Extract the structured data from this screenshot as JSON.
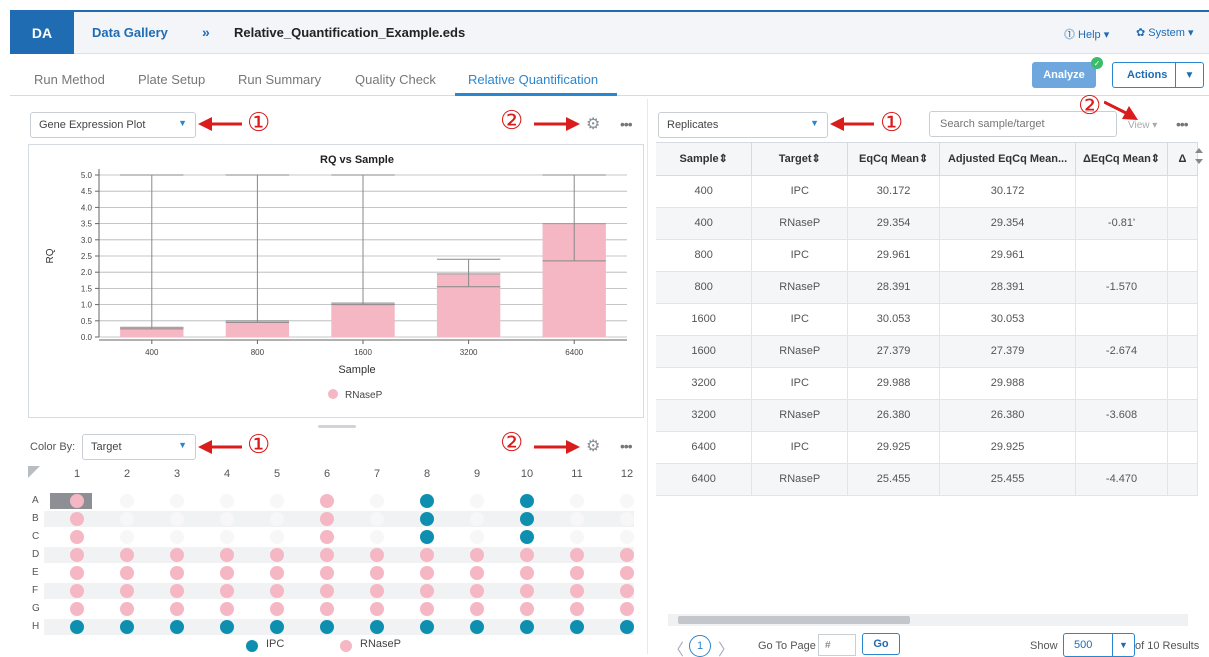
{
  "header": {
    "logo": "DA",
    "breadcrumb_root": "Data Gallery",
    "breadcrumb_sep": "»",
    "file_name": "Relative_Quantification_Example.eds",
    "help_label": "⓵ Help ▾",
    "system_label": "✿ System ▾"
  },
  "tabs": [
    {
      "label": "Run Method"
    },
    {
      "label": "Plate Setup"
    },
    {
      "label": "Run Summary"
    },
    {
      "label": "Quality Check"
    },
    {
      "label": "Relative Quantification"
    }
  ],
  "toolbar": {
    "analyze_label": "Analyze",
    "actions_label": "Actions"
  },
  "annotations": {
    "one": "①",
    "two": "②"
  },
  "left_panel": {
    "plot_select": "Gene Expression Plot",
    "dots": "•••"
  },
  "chart_data": {
    "type": "bar",
    "title": "RQ vs Sample",
    "xlabel": "Sample",
    "ylabel": "RQ",
    "categories": [
      "400",
      "800",
      "1600",
      "3200",
      "6400"
    ],
    "series": [
      {
        "name": "RNaseP",
        "color": "#f4b7c3",
        "values": [
          0.3,
          0.5,
          1.05,
          1.95,
          3.5
        ],
        "err_low": [
          0.25,
          0.45,
          1.0,
          1.55,
          2.35
        ],
        "err_high": [
          5.0,
          5.0,
          5.0,
          2.4,
          5.0
        ]
      }
    ],
    "y_ticks": [
      "0.0",
      "0.5",
      "1.0",
      "1.5",
      "2.0",
      "2.5",
      "3.0",
      "3.5",
      "4.0",
      "4.5",
      "5.0"
    ],
    "ylim": [
      0,
      5.0
    ],
    "grid": true,
    "legend": "bottom"
  },
  "plate": {
    "color_by_label": "Color By:",
    "color_by_value": "Target",
    "columns": [
      "1",
      "2",
      "3",
      "4",
      "5",
      "6",
      "7",
      "8",
      "9",
      "10",
      "11",
      "12"
    ],
    "rows": [
      "A",
      "B",
      "C",
      "D",
      "E",
      "F",
      "G",
      "H"
    ],
    "colors": {
      "I": "#0e8fb0",
      "R": "#f4b7c3",
      "E": "#f7f7f7"
    },
    "wells": [
      "REEEEREIEIEE",
      "REEEEREIEIEE",
      "REEEEREIEIEE",
      "RRRRRRRRRRRR",
      "RRRRRRRRRRRR",
      "RRRRRRRRRRRR",
      "RRRRRRRRRRRR",
      "IIIIIIIIIIII"
    ],
    "legend": [
      {
        "name": "IPC",
        "color": "#0e8fb0"
      },
      {
        "name": "RNaseP",
        "color": "#f4b7c3"
      }
    ]
  },
  "right_panel": {
    "view_select": "Replicates",
    "search_placeholder": "Search sample/target",
    "view_label": "View ▾",
    "dots": "•••"
  },
  "table": {
    "columns": [
      "Sample⇕",
      "Target⇕",
      "EqCq Mean⇕",
      "Adjusted EqCq Mean...",
      "ΔEqCq Mean⇕",
      "Δ"
    ],
    "rows": [
      [
        "400",
        "IPC",
        "30.172",
        "30.172",
        "",
        ""
      ],
      [
        "400",
        "RNaseP",
        "29.354",
        "29.354",
        "-0.81'",
        ""
      ],
      [
        "800",
        "IPC",
        "29.961",
        "29.961",
        "",
        ""
      ],
      [
        "800",
        "RNaseP",
        "28.391",
        "28.391",
        "-1.570",
        ""
      ],
      [
        "1600",
        "IPC",
        "30.053",
        "30.053",
        "",
        ""
      ],
      [
        "1600",
        "RNaseP",
        "27.379",
        "27.379",
        "-2.674",
        ""
      ],
      [
        "3200",
        "IPC",
        "29.988",
        "29.988",
        "",
        ""
      ],
      [
        "3200",
        "RNaseP",
        "26.380",
        "26.380",
        "-3.608",
        ""
      ],
      [
        "6400",
        "IPC",
        "29.925",
        "29.925",
        "",
        ""
      ],
      [
        "6400",
        "RNaseP",
        "25.455",
        "25.455",
        "-4.470",
        ""
      ]
    ]
  },
  "pagination": {
    "prev": "〈",
    "current": "1",
    "next": "〉",
    "goto_label": "Go To Page",
    "goto_placeholder": "#",
    "go_label": "Go",
    "show_label": "Show",
    "page_size": "500",
    "results_label": "of 10 Results"
  }
}
